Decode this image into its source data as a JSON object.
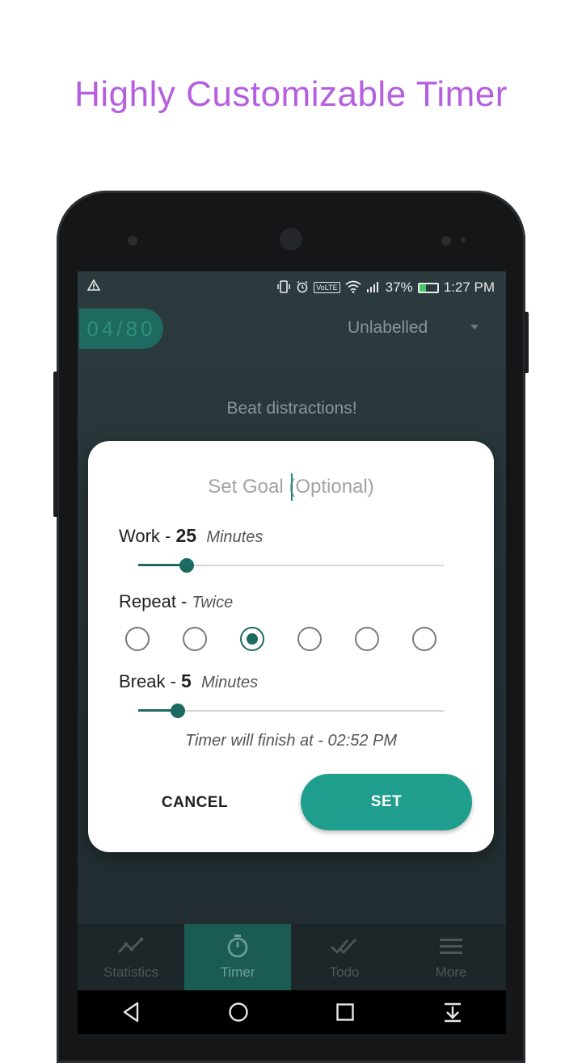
{
  "headline": "Highly Customizable Timer",
  "status_bar": {
    "warning_icon": "warning-icon",
    "battery_percent": "37%",
    "battery_level": 0.37,
    "time": "1:27 PM",
    "lte": "VoLTE"
  },
  "app": {
    "session_counter": "04/80",
    "label_selector": "Unlabelled",
    "motto": "Beat distractions!"
  },
  "dialog": {
    "goal_placeholder": "Set Goal (Optional)",
    "work": {
      "label": "Work - ",
      "value": "25",
      "unit": "Minutes",
      "slider_fraction": 0.16
    },
    "repeat": {
      "label": "Repeat - ",
      "value": "Twice",
      "options_count": 6,
      "selected_index": 2
    },
    "break": {
      "label": "Break - ",
      "value": "5",
      "unit": "Minutes",
      "slider_fraction": 0.13
    },
    "finish_text": "Timer will finish at - 02:52 PM",
    "cancel_label": "CANCEL",
    "set_label": "SET"
  },
  "bottom_nav": [
    {
      "label": "Statistics",
      "icon": "chart-icon",
      "active": false
    },
    {
      "label": "Timer",
      "icon": "stopwatch-icon",
      "active": true
    },
    {
      "label": "Todo",
      "icon": "double-check-icon",
      "active": false
    },
    {
      "label": "More",
      "icon": "menu-icon",
      "active": false
    }
  ],
  "colors": {
    "accent": "#1f9e8e",
    "headline": "#b55fe0"
  }
}
